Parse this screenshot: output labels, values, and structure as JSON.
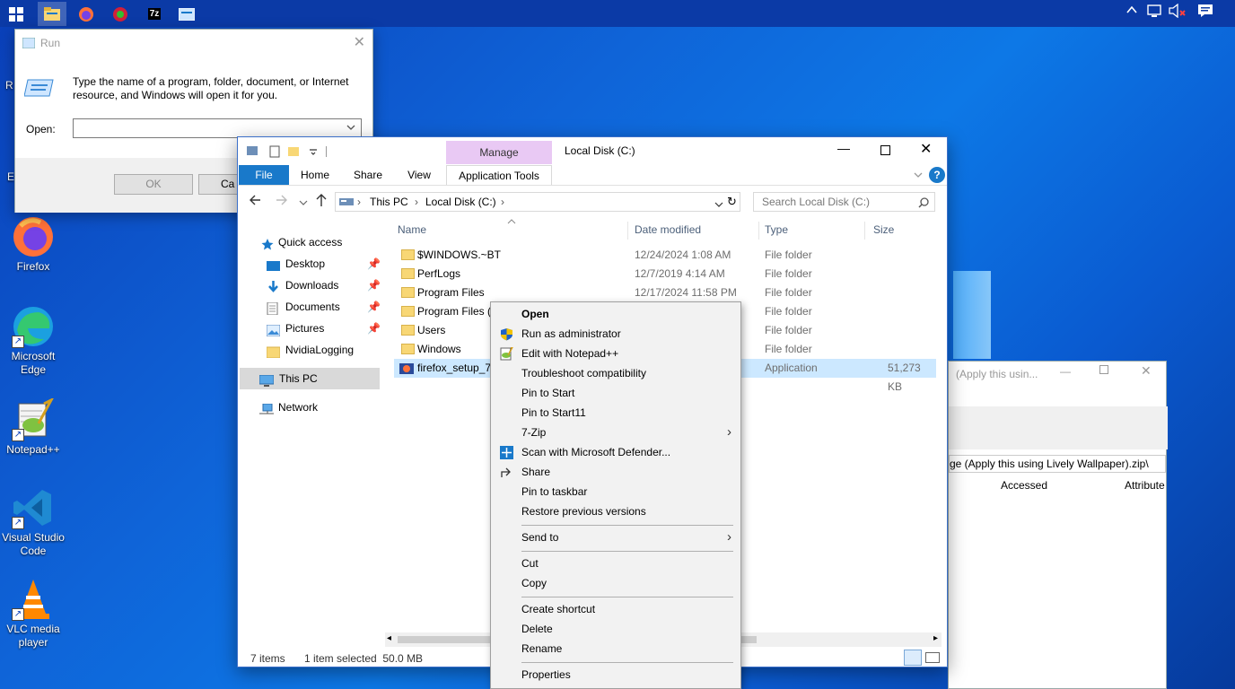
{
  "taskbar": {
    "items": [
      "start-icon",
      "file-explorer-icon",
      "firefox-icon",
      "rainbow-app-icon",
      "7zip-icon",
      "run-app-icon"
    ],
    "tray_icons": [
      "chevron-up-icon",
      "network-icon",
      "volume-muted-icon",
      "notifications-icon"
    ],
    "sevenzip_label": "7z"
  },
  "desktop": {
    "icons": [
      {
        "label": "Firefox"
      },
      {
        "label": "Microsoft Edge"
      },
      {
        "label": "Notepad++"
      },
      {
        "label": "Visual Studio Code"
      },
      {
        "label": "VLC media player"
      }
    ],
    "partial_labels": [
      "R",
      "E"
    ]
  },
  "run_dialog": {
    "title": "Run",
    "message": "Type the name of a program, folder, document, or Internet resource, and Windows will open it for you.",
    "open_label": "Open:",
    "open_value": "",
    "ok_label": "OK",
    "cancel_label": "Ca"
  },
  "explorer": {
    "title": "Local Disk (C:)",
    "manage_label": "Manage",
    "tabs": [
      "File",
      "Home",
      "Share",
      "View",
      "Application Tools"
    ],
    "breadcrumb": [
      "This PC",
      "Local Disk (C:)"
    ],
    "search_placeholder": "Search Local Disk (C:)",
    "nav": {
      "quick_access": "Quick access",
      "items": [
        "Desktop",
        "Downloads",
        "Documents",
        "Pictures",
        "NvidiaLogging"
      ],
      "this_pc": "This PC",
      "network": "Network"
    },
    "columns": [
      "Name",
      "Date modified",
      "Type",
      "Size"
    ],
    "rows": [
      {
        "name": "$WINDOWS.~BT",
        "date": "12/24/2024 1:08 AM",
        "type": "File folder",
        "size": ""
      },
      {
        "name": "PerfLogs",
        "date": "12/7/2019 4:14 AM",
        "type": "File folder",
        "size": ""
      },
      {
        "name": "Program Files",
        "date": "12/17/2024 11:58 PM",
        "type": "File folder",
        "size": ""
      },
      {
        "name": "Program Files (x",
        "date": "",
        "type": "File folder",
        "size": ""
      },
      {
        "name": "Users",
        "date": "",
        "type": "File folder",
        "size": ""
      },
      {
        "name": "Windows",
        "date": "",
        "type": "File folder",
        "size": ""
      },
      {
        "name": "firefox_setup_7",
        "date": "",
        "type": "Application",
        "size": "51,273 KB"
      }
    ],
    "status_items": "7 items",
    "status_selected": "1 item selected  50.0 MB"
  },
  "background_window": {
    "title_fragment": "(Apply this usin...",
    "path_fragment": "ge (Apply this using Lively Wallpaper).zip\\",
    "col_accessed": "Accessed",
    "col_attributes": "Attribute"
  },
  "context_menu": {
    "items": [
      {
        "label": "Open",
        "bold": true
      },
      {
        "label": "Run as administrator"
      },
      {
        "label": "Edit with Notepad++"
      },
      {
        "label": "Troubleshoot compatibility"
      },
      {
        "label": "Pin to Start"
      },
      {
        "label": "Pin to Start11"
      },
      {
        "label": "7-Zip",
        "submenu": true
      },
      {
        "label": "Scan with Microsoft Defender..."
      },
      {
        "label": "Share"
      },
      {
        "label": "Pin to taskbar"
      },
      {
        "label": "Restore previous versions"
      },
      {
        "label": "Send to",
        "submenu": true
      },
      {
        "label": "Cut"
      },
      {
        "label": "Copy"
      },
      {
        "label": "Create shortcut"
      },
      {
        "label": "Delete"
      },
      {
        "label": "Rename"
      },
      {
        "label": "Properties"
      }
    ]
  },
  "colors": {
    "taskbar": "#0b3aa6",
    "accent": "#1979ca",
    "manage_tab": "#e9c9f4",
    "selection": "#cce8ff"
  }
}
